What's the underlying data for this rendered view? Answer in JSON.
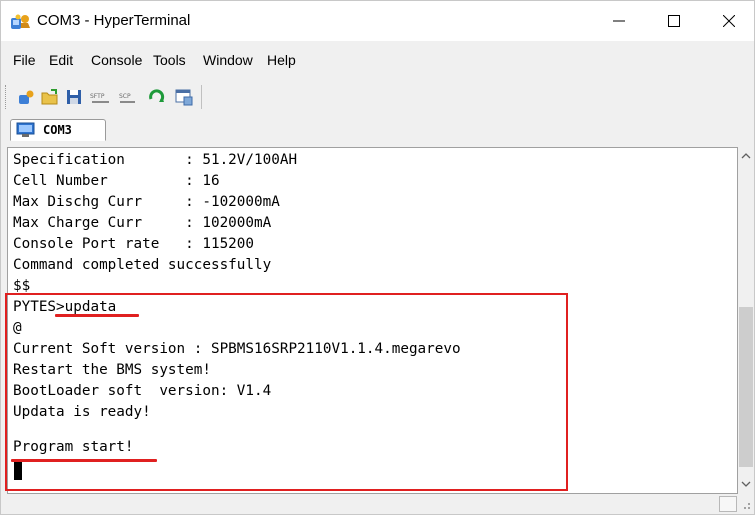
{
  "window": {
    "title": "COM3 - HyperTerminal"
  },
  "menu": {
    "items": [
      "File",
      "Edit",
      "Console",
      "Tools",
      "Window",
      "Help"
    ]
  },
  "toolbar": {
    "sftp_label": "SFTP",
    "scp_label": "SCP",
    "icons": [
      "new-session-icon",
      "open-folder-icon",
      "save-icon",
      "sftp-icon",
      "scp-icon",
      "reconnect-icon",
      "properties-icon"
    ]
  },
  "tab": {
    "label": "COM3"
  },
  "terminal": {
    "lines": [
      "Specification       : 51.2V/100AH",
      "Cell Number         : 16",
      "Max Dischg Curr     : -102000mA",
      "Max Charge Curr     : 102000mA",
      "Console Port rate   : 115200",
      "Command completed successfully",
      "$$",
      "PYTES>updata",
      "@",
      "Current Soft version : SPBMS16SRP2110V1.1.4.megarevo",
      "Restart the BMS system!",
      "BootLoader soft  version: V1.4",
      "Updata is ready!",
      "",
      "Program start!"
    ]
  },
  "colors": {
    "highlight": "#e02020",
    "terminal_bg": "#ffffff",
    "chrome_bg": "#f0f0f0"
  }
}
